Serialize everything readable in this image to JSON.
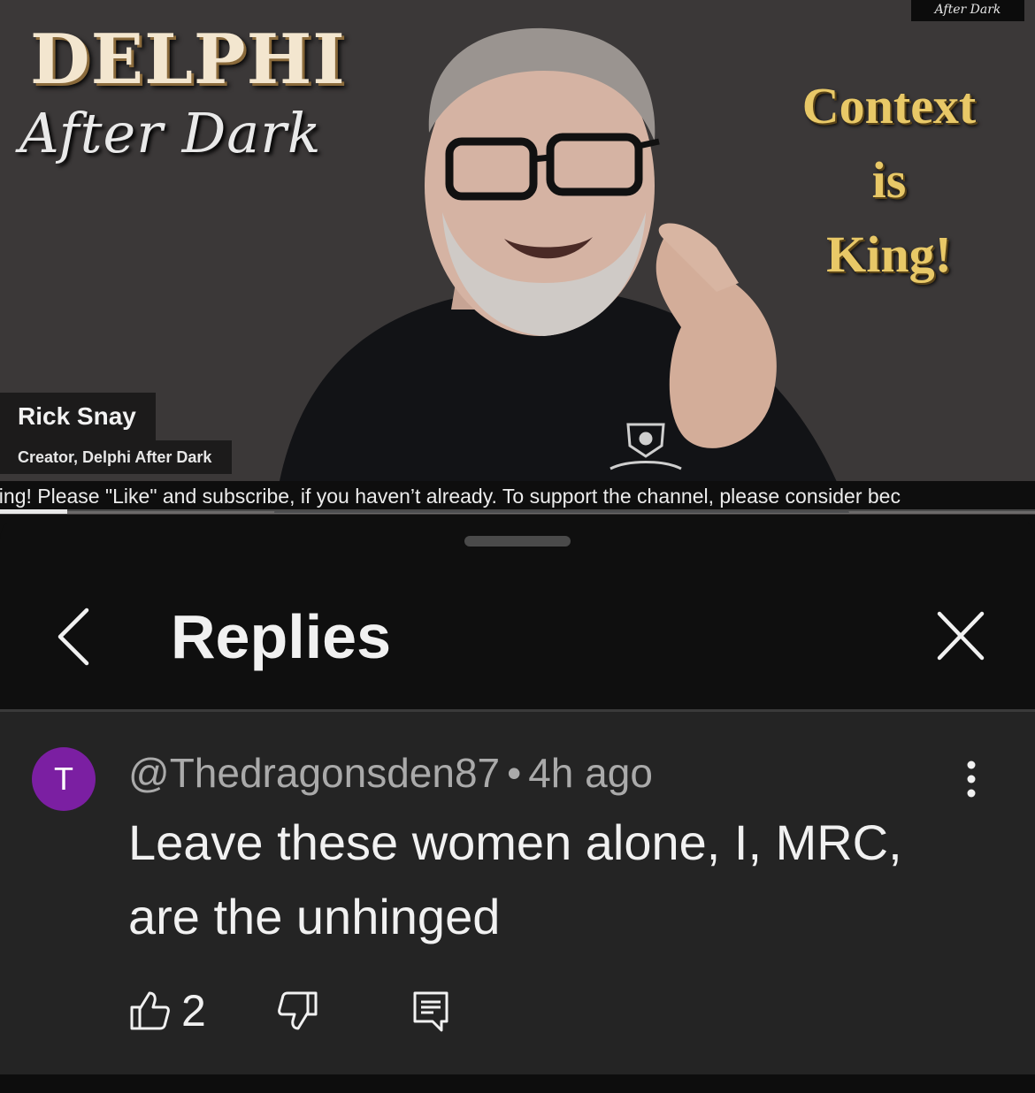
{
  "video": {
    "watermark": "After Dark",
    "logo_title": "DELPHI",
    "logo_subtitle": "After Dark",
    "slogan": [
      "Context",
      "is",
      "King!"
    ],
    "presenter_name": "Rick Snay",
    "presenter_title": "Creator, Delphi After Dark",
    "ticker_text": "hing! Please \"Like\" and subscribe, if you haven’t already. To support the channel, please consider bec",
    "progress_fraction": 0.065
  },
  "sheet": {
    "title": "Replies"
  },
  "comment": {
    "avatar_letter": "T",
    "avatar_color": "#7b1fa2",
    "author": "@Thedragonsden87",
    "separator": "•",
    "time": "4h ago",
    "text": "Leave these women alone, I, MRC, are the unhinged",
    "like_count": "2"
  },
  "icons": {
    "back": "chevron-left-icon",
    "close": "close-icon",
    "more": "more-vertical-icon",
    "like": "thumb-up-icon",
    "dislike": "thumb-down-icon",
    "reply": "comment-reply-icon"
  }
}
